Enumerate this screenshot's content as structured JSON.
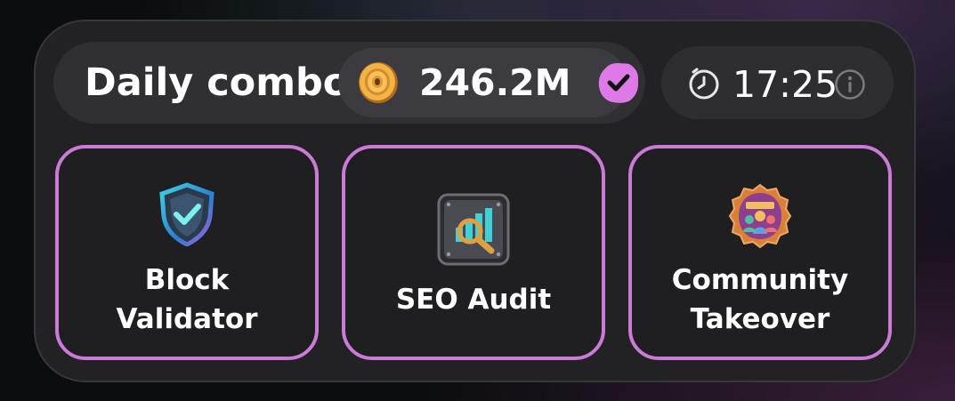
{
  "header": {
    "title": "Daily combo",
    "reward": "246.2M",
    "reward_icon": "coin-icon",
    "claimed_icon": "checkmark-badge-icon",
    "timer": "17:25",
    "timer_icon": "clock-icon",
    "info_icon": "info-icon"
  },
  "cards": [
    {
      "line1": "Block",
      "line2": "Validator",
      "icon": "shield-check-icon"
    },
    {
      "line1": "SEO Audit",
      "icon": "seo-chart-magnifier-icon"
    },
    {
      "line1": "Community",
      "line2": "Takeover",
      "icon": "community-badge-icon"
    }
  ],
  "colors": {
    "accent": "#cc7ad8",
    "panel": "#222224",
    "pill": "#303033",
    "coin": "#e8a33a",
    "badge": "#e079e8"
  }
}
